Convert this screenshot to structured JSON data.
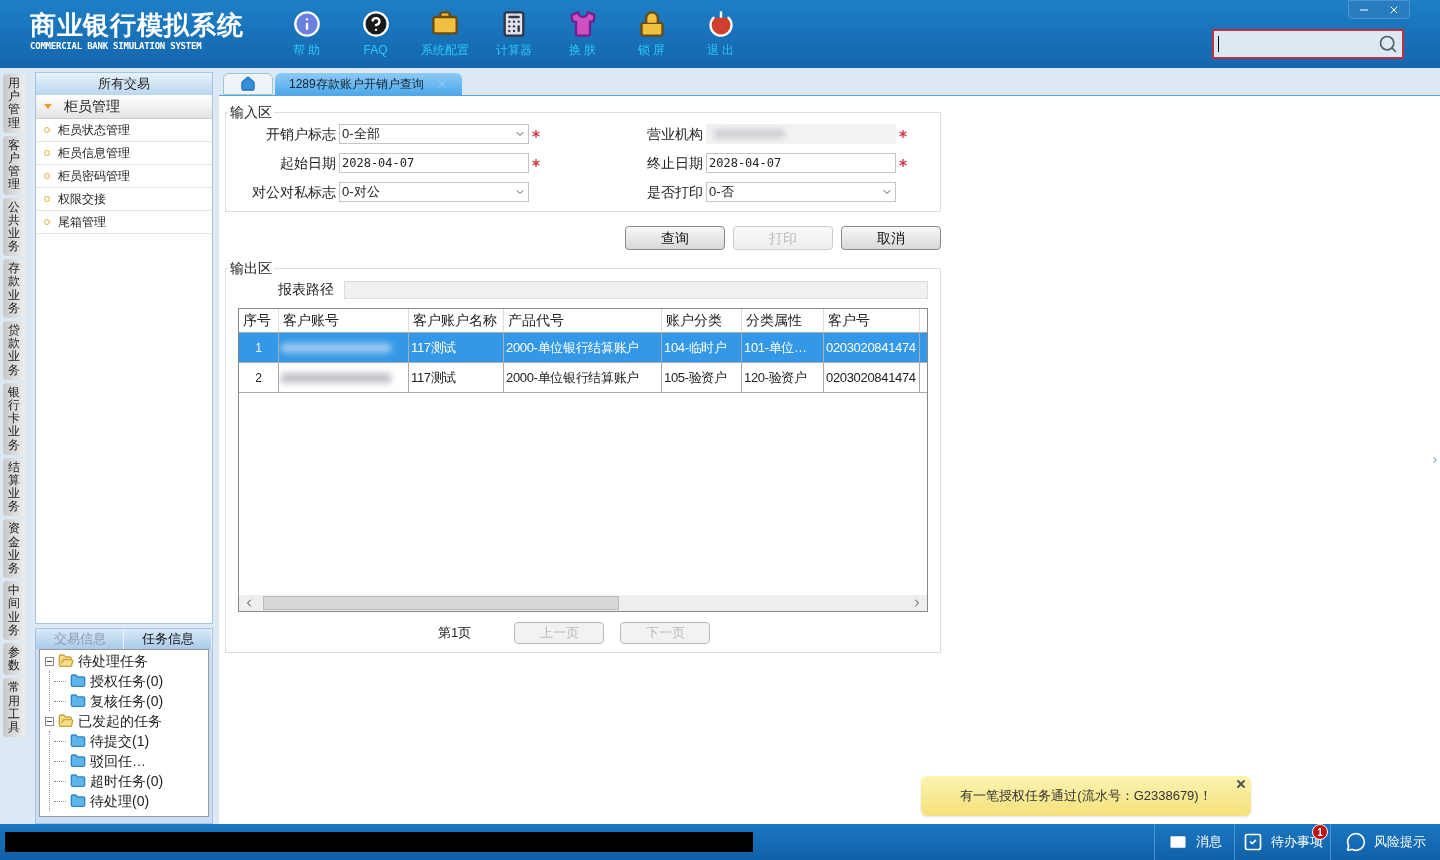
{
  "header": {
    "title": "商业银行模拟系统",
    "subtitle": "COMMERCIAL BANK SIMULATION SYSTEM",
    "tools": [
      {
        "kind": "help",
        "label": "帮 助"
      },
      {
        "kind": "faq",
        "label": "FAQ"
      },
      {
        "kind": "config",
        "label": "系统配置"
      },
      {
        "kind": "calc",
        "label": "计算器"
      },
      {
        "kind": "skin",
        "label": "换 肤"
      },
      {
        "kind": "lock",
        "label": "锁 屏"
      },
      {
        "kind": "exit",
        "label": "退 出"
      }
    ]
  },
  "side_tabs": [
    "用户管理",
    "客户管理",
    "公共业务",
    "存款业务",
    "贷款业务",
    "银行卡业务",
    "结算业务",
    "资金业务",
    "中间业务",
    "参数",
    "常用工具"
  ],
  "sidebar": {
    "title": "所有交易",
    "group": {
      "label": "柜员管理",
      "expanded": true,
      "items": [
        "柜员状态管理",
        "柜员信息管理",
        "柜员密码管理",
        "权限交接",
        "尾箱管理"
      ]
    },
    "info_tabs": [
      {
        "label": "交易信息",
        "selected": false
      },
      {
        "label": "任务信息",
        "selected": true
      }
    ],
    "tree": [
      {
        "label": "待处理任务",
        "expanded": true,
        "children": [
          {
            "label": "授权任务(0)"
          },
          {
            "label": "复核任务(0)"
          }
        ]
      },
      {
        "label": "已发起的任务",
        "expanded": true,
        "children": [
          {
            "label": "待提交(1)"
          },
          {
            "label": "驳回任…"
          },
          {
            "label": "超时任务(0)"
          },
          {
            "label": "待处理(0)"
          }
        ]
      }
    ]
  },
  "tabs": [
    {
      "kind": "home",
      "selected": false
    },
    {
      "kind": "page",
      "label": "1289存款账户开销户查询",
      "selected": true
    }
  ],
  "input_area": {
    "title": "输入区",
    "fields": [
      {
        "label": "开销户标志",
        "kind": "select",
        "value": "0-全部",
        "required": true
      },
      {
        "label": "营业机构",
        "kind": "text",
        "masked": true,
        "required": true
      },
      {
        "label": "起始日期",
        "kind": "text",
        "value": "2028-04-07",
        "required": true
      },
      {
        "label": "终止日期",
        "kind": "text",
        "value": "2028-04-07",
        "required": true
      },
      {
        "label": "对公对私标志",
        "kind": "select",
        "value": "0-对公",
        "required": false
      },
      {
        "label": "是否打印",
        "kind": "select",
        "value": "0-否",
        "required": false
      }
    ]
  },
  "buttons": [
    {
      "label": "查询",
      "disabled": false
    },
    {
      "label": "打印",
      "disabled": true
    },
    {
      "label": "取消",
      "disabled": false
    }
  ],
  "output_area": {
    "title": "输出区",
    "path_label": "报表路径",
    "table": {
      "columns": [
        "序号",
        "客户账号",
        "客户账户名称",
        "产品代号",
        "账户分类",
        "分类属性",
        "客户号"
      ],
      "rows": [
        {
          "selected": true,
          "cells": [
            "1",
            null,
            "117测试",
            "2000-单位银行结算账户",
            "104-临时户",
            "101-单位…",
            "0203020841474"
          ]
        },
        {
          "selected": false,
          "cells": [
            "2",
            null,
            "117测试",
            "2000-单位银行结算账户",
            "105-验资户",
            "120-验资户",
            "0203020841474"
          ]
        }
      ]
    },
    "pager": {
      "page": "第1页",
      "prev": {
        "label": "上一页",
        "disabled": true
      },
      "next": {
        "label": "下一页",
        "disabled": true
      }
    }
  },
  "toast": {
    "message": "有一笔授权任务通过(流水号：G2338679)！"
  },
  "status_bar": [
    {
      "kind": "mail",
      "label": "消息"
    },
    {
      "kind": "todo",
      "label": "待办事项",
      "badge": "1"
    },
    {
      "kind": "risk",
      "label": "风险提示"
    }
  ]
}
